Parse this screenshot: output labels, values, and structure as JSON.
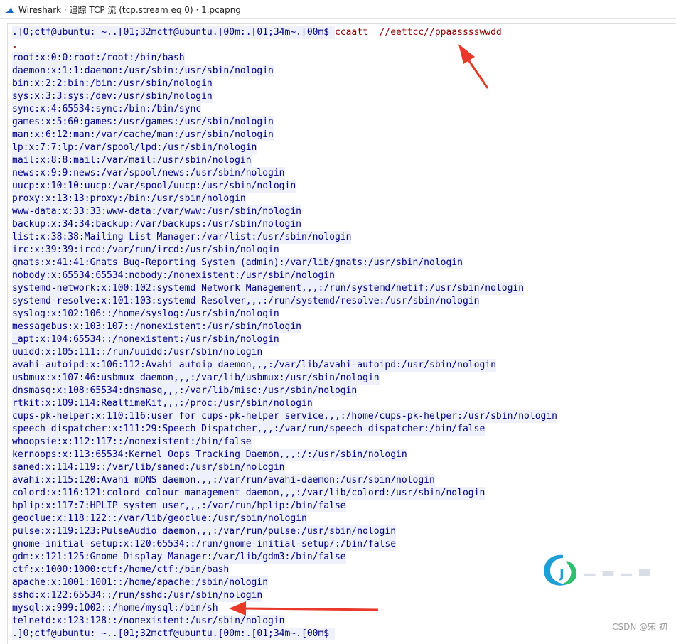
{
  "window": {
    "title": "Wireshark · 追踪 TCP 流 (tcp.stream eq 0) · 1.pcapng",
    "icon": "wireshark-fin-icon",
    "accent_color": "#1a66c4"
  },
  "stream": {
    "client_color": "#8b0000",
    "server_color": "#000080",
    "server_bg": "#eef0fb",
    "lines": [
      [
        {
          "t": ".]0;ctf@ubuntu: ~..[01;32mctf@ubuntu.[00m:.[01;34m~.[00m$ ",
          "s": "server"
        },
        {
          "t": "ccaatt  //eettcc//ppaasssswwdd",
          "s": "client"
        }
      ],
      [
        {
          "t": ".",
          "s": "client"
        }
      ],
      [
        {
          "t": "root:x:0:0:root:/root:/bin/bash",
          "s": "server"
        }
      ],
      [
        {
          "t": "daemon:x:1:1:daemon:/usr/sbin:/usr/sbin/nologin",
          "s": "server"
        }
      ],
      [
        {
          "t": "bin:x:2:2:bin:/bin:/usr/sbin/nologin",
          "s": "server"
        }
      ],
      [
        {
          "t": "sys:x:3:3:sys:/dev:/usr/sbin/nologin",
          "s": "server"
        }
      ],
      [
        {
          "t": "sync:x:4:65534:sync:/bin:/bin/sync",
          "s": "server"
        }
      ],
      [
        {
          "t": "games:x:5:60:games:/usr/games:/usr/sbin/nologin",
          "s": "server"
        }
      ],
      [
        {
          "t": "man:x:6:12:man:/var/cache/man:/usr/sbin/nologin",
          "s": "server"
        }
      ],
      [
        {
          "t": "lp:x:7:7:lp:/var/spool/lpd:/usr/sbin/nologin",
          "s": "server"
        }
      ],
      [
        {
          "t": "mail:x:8:8:mail:/var/mail:/usr/sbin/nologin",
          "s": "server"
        }
      ],
      [
        {
          "t": "news:x:9:9:news:/var/spool/news:/usr/sbin/nologin",
          "s": "server"
        }
      ],
      [
        {
          "t": "uucp:x:10:10:uucp:/var/spool/uucp:/usr/sbin/nologin",
          "s": "server"
        }
      ],
      [
        {
          "t": "proxy:x:13:13:proxy:/bin:/usr/sbin/nologin",
          "s": "server"
        }
      ],
      [
        {
          "t": "www-data:x:33:33:www-data:/var/www:/usr/sbin/nologin",
          "s": "server"
        }
      ],
      [
        {
          "t": "backup:x:34:34:backup:/var/backups:/usr/sbin/nologin",
          "s": "server"
        }
      ],
      [
        {
          "t": "list:x:38:38:Mailing List Manager:/var/list:/usr/sbin/nologin",
          "s": "server"
        }
      ],
      [
        {
          "t": "irc:x:39:39:ircd:/var/run/ircd:/usr/sbin/nologin",
          "s": "server"
        }
      ],
      [
        {
          "t": "gnats:x:41:41:Gnats Bug-Reporting System (admin):/var/lib/gnats:/usr/sbin/nologin",
          "s": "server"
        }
      ],
      [
        {
          "t": "nobody:x:65534:65534:nobody:/nonexistent:/usr/sbin/nologin",
          "s": "server"
        }
      ],
      [
        {
          "t": "systemd-network:x:100:102:systemd Network Management,,,:/run/systemd/netif:/usr/sbin/nologin",
          "s": "server"
        }
      ],
      [
        {
          "t": "systemd-resolve:x:101:103:systemd Resolver,,,:/run/systemd/resolve:/usr/sbin/nologin",
          "s": "server"
        }
      ],
      [
        {
          "t": "syslog:x:102:106::/home/syslog:/usr/sbin/nologin",
          "s": "server"
        }
      ],
      [
        {
          "t": "messagebus:x:103:107::/nonexistent:/usr/sbin/nologin",
          "s": "server"
        }
      ],
      [
        {
          "t": "_apt:x:104:65534::/nonexistent:/usr/sbin/nologin",
          "s": "server"
        }
      ],
      [
        {
          "t": "uuidd:x:105:111::/run/uuidd:/usr/sbin/nologin",
          "s": "server"
        }
      ],
      [
        {
          "t": "avahi-autoipd:x:106:112:Avahi autoip daemon,,,:/var/lib/avahi-autoipd:/usr/sbin/nologin",
          "s": "server"
        }
      ],
      [
        {
          "t": "usbmux:x:107:46:usbmux daemon,,,:/var/lib/usbmux:/usr/sbin/nologin",
          "s": "server"
        }
      ],
      [
        {
          "t": "dnsmasq:x:108:65534:dnsmasq,,,:/var/lib/misc:/usr/sbin/nologin",
          "s": "server"
        }
      ],
      [
        {
          "t": "rtkit:x:109:114:RealtimeKit,,,:/proc:/usr/sbin/nologin",
          "s": "server"
        }
      ],
      [
        {
          "t": "cups-pk-helper:x:110:116:user for cups-pk-helper service,,,:/home/cups-pk-helper:/usr/sbin/nologin",
          "s": "server"
        }
      ],
      [
        {
          "t": "speech-dispatcher:x:111:29:Speech Dispatcher,,,:/var/run/speech-dispatcher:/bin/false",
          "s": "server"
        }
      ],
      [
        {
          "t": "whoopsie:x:112:117::/nonexistent:/bin/false",
          "s": "server"
        }
      ],
      [
        {
          "t": "kernoops:x:113:65534:Kernel Oops Tracking Daemon,,,:/:/usr/sbin/nologin",
          "s": "server"
        }
      ],
      [
        {
          "t": "saned:x:114:119::/var/lib/saned:/usr/sbin/nologin",
          "s": "server"
        }
      ],
      [
        {
          "t": "avahi:x:115:120:Avahi mDNS daemon,,,:/var/run/avahi-daemon:/usr/sbin/nologin",
          "s": "server"
        }
      ],
      [
        {
          "t": "colord:x:116:121:colord colour management daemon,,,:/var/lib/colord:/usr/sbin/nologin",
          "s": "server"
        }
      ],
      [
        {
          "t": "hplip:x:117:7:HPLIP system user,,,:/var/run/hplip:/bin/false",
          "s": "server"
        }
      ],
      [
        {
          "t": "geoclue:x:118:122::/var/lib/geoclue:/usr/sbin/nologin",
          "s": "server"
        }
      ],
      [
        {
          "t": "pulse:x:119:123:PulseAudio daemon,,,:/var/run/pulse:/usr/sbin/nologin",
          "s": "server"
        }
      ],
      [
        {
          "t": "gnome-initial-setup:x:120:65534::/run/gnome-initial-setup/:/bin/false",
          "s": "server"
        }
      ],
      [
        {
          "t": "gdm:x:121:125:Gnome Display Manager:/var/lib/gdm3:/bin/false",
          "s": "server"
        }
      ],
      [
        {
          "t": "ctf:x:1000:1000:ctf:/home/ctf:/bin/bash",
          "s": "server"
        }
      ],
      [
        {
          "t": "apache:x:1001:1001::/home/apache:/sbin/nologin",
          "s": "server"
        }
      ],
      [
        {
          "t": "sshd:x:122:65534::/run/sshd:/usr/sbin/nologin",
          "s": "server"
        }
      ],
      [
        {
          "t": "mysql:x:999:1002::/home/mysql:/bin/sh",
          "s": "server"
        }
      ],
      [
        {
          "t": "telnetd:x:123:128::/nonexistent:/usr/sbin/nologin",
          "s": "server"
        }
      ],
      [
        {
          "t": ".]0;ctf@ubuntu: ~..[01;32mctf@ubuntu.[00m:.[01;34m~.[00m$ ",
          "s": "server"
        }
      ]
    ]
  },
  "annotations": {
    "arrow_color": "#e8392b",
    "arrows": [
      "arrow-to-command",
      "arrow-to-mysql-line"
    ]
  },
  "watermark": {
    "credit": "CSDN @宋 初",
    "logo_icon": "circle-logo-icon"
  }
}
